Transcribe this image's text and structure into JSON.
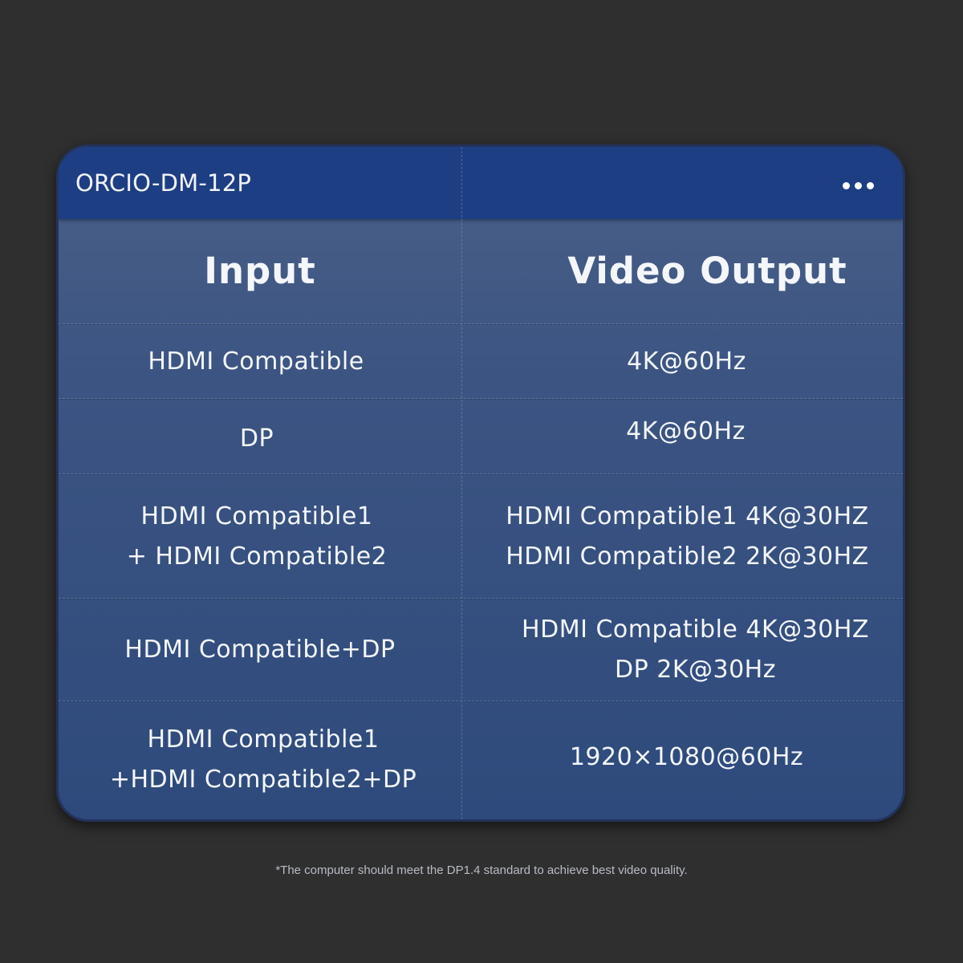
{
  "card": {
    "model": "ORCIO-DM-12P",
    "more_icon": "more-horizontal-icon"
  },
  "table": {
    "headers": [
      "Input",
      "Video Output"
    ],
    "rows": [
      {
        "input": [
          "HDMI Compatible"
        ],
        "output": [
          "4K@60Hz"
        ]
      },
      {
        "input": [
          "DP"
        ],
        "output": [
          "4K@60Hz"
        ]
      },
      {
        "input": [
          "HDMI Compatible1",
          "+ HDMI Compatible2"
        ],
        "output": [
          "HDMI Compatible1 4K@30HZ",
          "HDMI Compatible2 2K@30HZ"
        ]
      },
      {
        "input": [
          "HDMI Compatible+DP"
        ],
        "output": [
          "HDMI Compatible 4K@30HZ",
          "DP 2K@30Hz"
        ]
      },
      {
        "input": [
          "HDMI Compatible1",
          "+HDMI Compatible2+DP"
        ],
        "output": [
          "1920×1080@60Hz"
        ]
      }
    ]
  },
  "footnote": "*The computer should meet the DP1.4 standard to achieve best video quality.",
  "colors": {
    "background": "#2f2f30",
    "header_bar": "#1e3e84",
    "card_body": "#3c5482",
    "text": "#f4f6fa"
  }
}
